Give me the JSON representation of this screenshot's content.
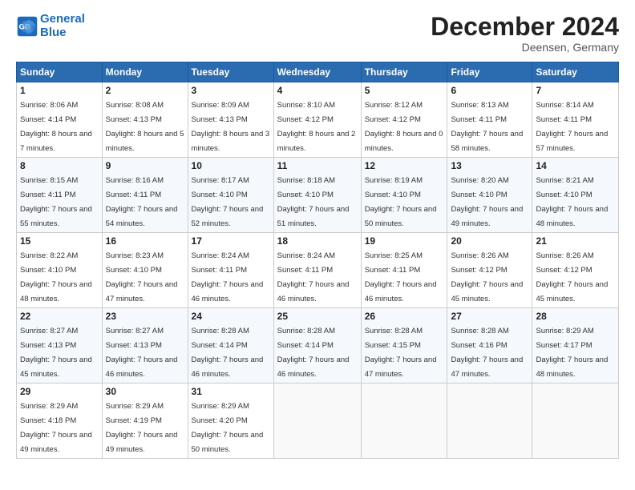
{
  "header": {
    "logo_line1": "General",
    "logo_line2": "Blue",
    "month": "December 2024",
    "location": "Deensen, Germany"
  },
  "weekdays": [
    "Sunday",
    "Monday",
    "Tuesday",
    "Wednesday",
    "Thursday",
    "Friday",
    "Saturday"
  ],
  "weeks": [
    [
      {
        "day": "1",
        "sunrise": "Sunrise: 8:06 AM",
        "sunset": "Sunset: 4:14 PM",
        "daylight": "Daylight: 8 hours and 7 minutes."
      },
      {
        "day": "2",
        "sunrise": "Sunrise: 8:08 AM",
        "sunset": "Sunset: 4:13 PM",
        "daylight": "Daylight: 8 hours and 5 minutes."
      },
      {
        "day": "3",
        "sunrise": "Sunrise: 8:09 AM",
        "sunset": "Sunset: 4:13 PM",
        "daylight": "Daylight: 8 hours and 3 minutes."
      },
      {
        "day": "4",
        "sunrise": "Sunrise: 8:10 AM",
        "sunset": "Sunset: 4:12 PM",
        "daylight": "Daylight: 8 hours and 2 minutes."
      },
      {
        "day": "5",
        "sunrise": "Sunrise: 8:12 AM",
        "sunset": "Sunset: 4:12 PM",
        "daylight": "Daylight: 8 hours and 0 minutes."
      },
      {
        "day": "6",
        "sunrise": "Sunrise: 8:13 AM",
        "sunset": "Sunset: 4:11 PM",
        "daylight": "Daylight: 7 hours and 58 minutes."
      },
      {
        "day": "7",
        "sunrise": "Sunrise: 8:14 AM",
        "sunset": "Sunset: 4:11 PM",
        "daylight": "Daylight: 7 hours and 57 minutes."
      }
    ],
    [
      {
        "day": "8",
        "sunrise": "Sunrise: 8:15 AM",
        "sunset": "Sunset: 4:11 PM",
        "daylight": "Daylight: 7 hours and 55 minutes."
      },
      {
        "day": "9",
        "sunrise": "Sunrise: 8:16 AM",
        "sunset": "Sunset: 4:11 PM",
        "daylight": "Daylight: 7 hours and 54 minutes."
      },
      {
        "day": "10",
        "sunrise": "Sunrise: 8:17 AM",
        "sunset": "Sunset: 4:10 PM",
        "daylight": "Daylight: 7 hours and 52 minutes."
      },
      {
        "day": "11",
        "sunrise": "Sunrise: 8:18 AM",
        "sunset": "Sunset: 4:10 PM",
        "daylight": "Daylight: 7 hours and 51 minutes."
      },
      {
        "day": "12",
        "sunrise": "Sunrise: 8:19 AM",
        "sunset": "Sunset: 4:10 PM",
        "daylight": "Daylight: 7 hours and 50 minutes."
      },
      {
        "day": "13",
        "sunrise": "Sunrise: 8:20 AM",
        "sunset": "Sunset: 4:10 PM",
        "daylight": "Daylight: 7 hours and 49 minutes."
      },
      {
        "day": "14",
        "sunrise": "Sunrise: 8:21 AM",
        "sunset": "Sunset: 4:10 PM",
        "daylight": "Daylight: 7 hours and 48 minutes."
      }
    ],
    [
      {
        "day": "15",
        "sunrise": "Sunrise: 8:22 AM",
        "sunset": "Sunset: 4:10 PM",
        "daylight": "Daylight: 7 hours and 48 minutes."
      },
      {
        "day": "16",
        "sunrise": "Sunrise: 8:23 AM",
        "sunset": "Sunset: 4:10 PM",
        "daylight": "Daylight: 7 hours and 47 minutes."
      },
      {
        "day": "17",
        "sunrise": "Sunrise: 8:24 AM",
        "sunset": "Sunset: 4:11 PM",
        "daylight": "Daylight: 7 hours and 46 minutes."
      },
      {
        "day": "18",
        "sunrise": "Sunrise: 8:24 AM",
        "sunset": "Sunset: 4:11 PM",
        "daylight": "Daylight: 7 hours and 46 minutes."
      },
      {
        "day": "19",
        "sunrise": "Sunrise: 8:25 AM",
        "sunset": "Sunset: 4:11 PM",
        "daylight": "Daylight: 7 hours and 46 minutes."
      },
      {
        "day": "20",
        "sunrise": "Sunrise: 8:26 AM",
        "sunset": "Sunset: 4:12 PM",
        "daylight": "Daylight: 7 hours and 45 minutes."
      },
      {
        "day": "21",
        "sunrise": "Sunrise: 8:26 AM",
        "sunset": "Sunset: 4:12 PM",
        "daylight": "Daylight: 7 hours and 45 minutes."
      }
    ],
    [
      {
        "day": "22",
        "sunrise": "Sunrise: 8:27 AM",
        "sunset": "Sunset: 4:13 PM",
        "daylight": "Daylight: 7 hours and 45 minutes."
      },
      {
        "day": "23",
        "sunrise": "Sunrise: 8:27 AM",
        "sunset": "Sunset: 4:13 PM",
        "daylight": "Daylight: 7 hours and 46 minutes."
      },
      {
        "day": "24",
        "sunrise": "Sunrise: 8:28 AM",
        "sunset": "Sunset: 4:14 PM",
        "daylight": "Daylight: 7 hours and 46 minutes."
      },
      {
        "day": "25",
        "sunrise": "Sunrise: 8:28 AM",
        "sunset": "Sunset: 4:14 PM",
        "daylight": "Daylight: 7 hours and 46 minutes."
      },
      {
        "day": "26",
        "sunrise": "Sunrise: 8:28 AM",
        "sunset": "Sunset: 4:15 PM",
        "daylight": "Daylight: 7 hours and 47 minutes."
      },
      {
        "day": "27",
        "sunrise": "Sunrise: 8:28 AM",
        "sunset": "Sunset: 4:16 PM",
        "daylight": "Daylight: 7 hours and 47 minutes."
      },
      {
        "day": "28",
        "sunrise": "Sunrise: 8:29 AM",
        "sunset": "Sunset: 4:17 PM",
        "daylight": "Daylight: 7 hours and 48 minutes."
      }
    ],
    [
      {
        "day": "29",
        "sunrise": "Sunrise: 8:29 AM",
        "sunset": "Sunset: 4:18 PM",
        "daylight": "Daylight: 7 hours and 49 minutes."
      },
      {
        "day": "30",
        "sunrise": "Sunrise: 8:29 AM",
        "sunset": "Sunset: 4:19 PM",
        "daylight": "Daylight: 7 hours and 49 minutes."
      },
      {
        "day": "31",
        "sunrise": "Sunrise: 8:29 AM",
        "sunset": "Sunset: 4:20 PM",
        "daylight": "Daylight: 7 hours and 50 minutes."
      },
      null,
      null,
      null,
      null
    ]
  ]
}
